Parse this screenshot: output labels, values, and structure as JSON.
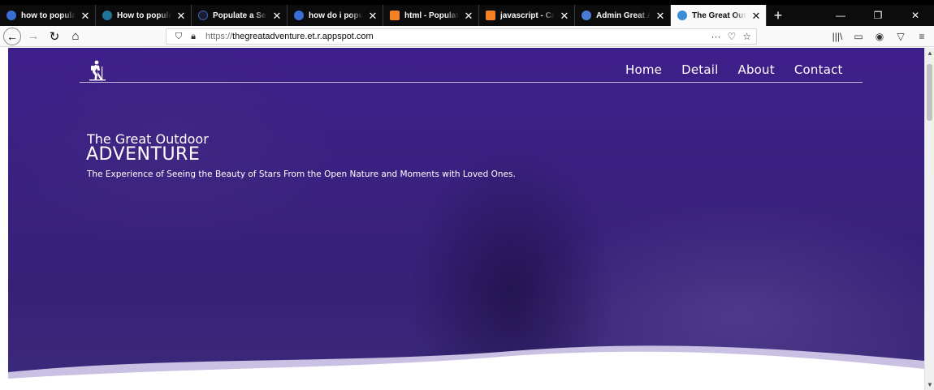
{
  "browser": {
    "tabs": [
      {
        "title": "how to populate",
        "favicon_color": "#3b6dd6",
        "active": false
      },
      {
        "title": "How to populate",
        "favicon_color": "#21759b",
        "active": false
      },
      {
        "title": "Populate a Select",
        "favicon_color": "#1c1c2e",
        "active": false
      },
      {
        "title": "how do i populate",
        "favicon_color": "#3b6dd6",
        "active": false
      },
      {
        "title": "html - Populate",
        "favicon_color": "#f48024",
        "active": false
      },
      {
        "title": "javascript - Can",
        "favicon_color": "#f48024",
        "active": false
      },
      {
        "title": "Admin Great Ad",
        "favicon_color": "#4a7bd6",
        "active": false
      },
      {
        "title": "The Great Outdo",
        "favicon_color": "#3b8bd6",
        "active": true
      }
    ],
    "new_tab": "+",
    "window_controls": {
      "minimize": "—",
      "restore": "❐",
      "close": "✕"
    },
    "url_scheme": "https://",
    "url_host": "thegreatadventure.et.r.appspot.com",
    "url_actions": {
      "more": "···",
      "pocket": "♡",
      "bookmark": "☆"
    },
    "nav": {
      "back": "←",
      "forward": "→",
      "reload": "↻",
      "home": "⌂"
    },
    "toolbar_icons": {
      "library": "|||\\",
      "sidebar": "▭",
      "account": "◉",
      "extension": "▽",
      "menu": "≡"
    }
  },
  "site": {
    "menu": [
      {
        "label": "Home"
      },
      {
        "label": "Detail"
      },
      {
        "label": "About"
      },
      {
        "label": "Contact"
      }
    ],
    "hero": {
      "subtitle": "The Great Outdoor",
      "title": "ADVENTURE",
      "tagline": "The Experience of Seeing the Beauty of Stars From the Open Nature and Moments with Loved Ones."
    },
    "colors": {
      "overlay": "#3a2180",
      "wave": "#ffffff",
      "wave_shadow": "#c9c0e3"
    }
  }
}
